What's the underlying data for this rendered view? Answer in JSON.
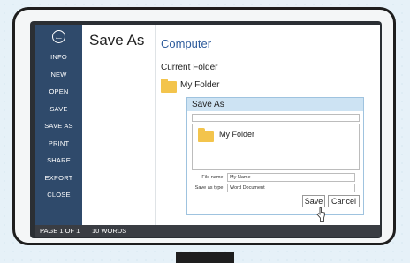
{
  "sidebar": {
    "back_symbol": "←",
    "items": [
      {
        "label": "INFO"
      },
      {
        "label": "NEW"
      },
      {
        "label": "OPEN"
      },
      {
        "label": "SAVE"
      },
      {
        "label": "SAVE AS"
      },
      {
        "label": "PRINT"
      },
      {
        "label": "SHARE"
      },
      {
        "label": "EXPORT"
      },
      {
        "label": "CLOSE"
      }
    ]
  },
  "middle": {
    "title": "Save As"
  },
  "right": {
    "location": "Computer",
    "current_folder_label": "Current Folder",
    "current_folder_name": "My Folder"
  },
  "dialog": {
    "title": "Save As",
    "folder_name": "My Folder",
    "file_name_label": "File name:",
    "file_name_value": "My Name",
    "save_as_type_label": "Save as type:",
    "save_as_type_value": "Word Document",
    "save_label": "Save",
    "cancel_label": "Cancel"
  },
  "status": {
    "page": "PAGE 1 OF 1",
    "words": "10 WORDS"
  },
  "colors": {
    "sidebar": "#2f4a6b",
    "accent_text": "#2e5c9c",
    "folder": "#f3c44c",
    "dialog_title": "#cde3f3"
  }
}
